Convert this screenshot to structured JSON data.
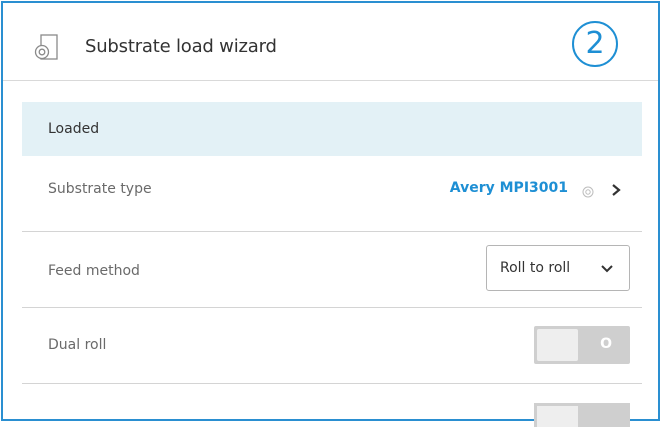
{
  "header": {
    "title": "Substrate load wizard",
    "step": "2"
  },
  "section": {
    "label": "Loaded"
  },
  "rows": {
    "substrate_type": {
      "label": "Substrate type",
      "value": "Avery MPI3001"
    },
    "feed_method": {
      "label": "Feed method",
      "value": "Roll to roll"
    },
    "dual_roll": {
      "label": "Dual roll",
      "toggle_text": "O"
    }
  },
  "colors": {
    "accent": "#1e8fd4",
    "frame_border": "#2a8fd1",
    "section_bg": "#e3f1f6",
    "toggle_off": "#cfcfcf"
  },
  "icons": {
    "header": "substrate-roll-icon",
    "substrate": "substrate-info-icon",
    "navigate": "chevron-right-icon",
    "dropdown": "chevron-down-icon"
  }
}
